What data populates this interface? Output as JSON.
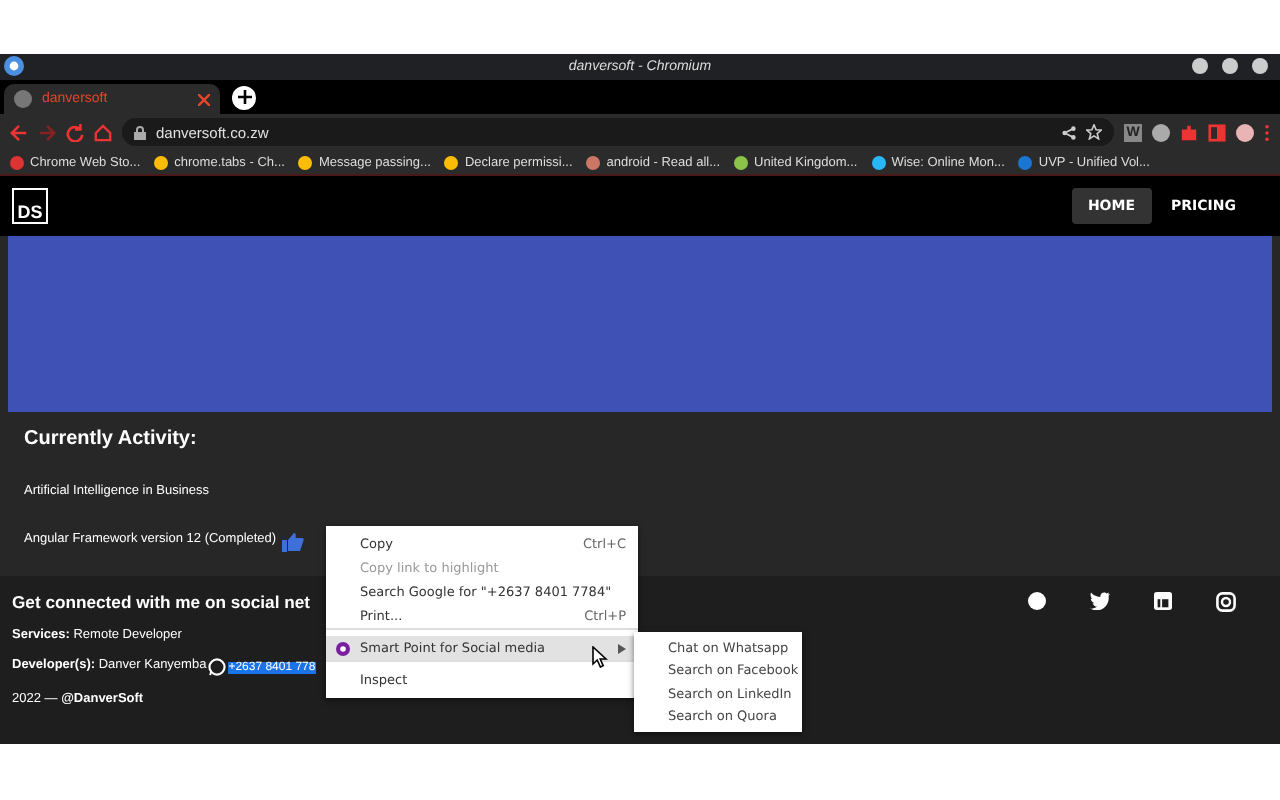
{
  "window": {
    "title": "danversoft - Chromium"
  },
  "tabs": [
    {
      "label": "danversoft",
      "selected": true
    }
  ],
  "address_bar": {
    "url": "danversoft.co.zw"
  },
  "extensions": [
    {
      "label": "W"
    }
  ],
  "bookmarks": [
    {
      "label": "Chrome Web Sto..."
    },
    {
      "label": "chrome.tabs - Ch..."
    },
    {
      "label": "Message passing..."
    },
    {
      "label": "Declare permissi..."
    },
    {
      "label": "android - Read all..."
    },
    {
      "label": "United Kingdom..."
    },
    {
      "label": "Wise: Online Mon..."
    },
    {
      "label": "UVP - Unified Vol..."
    }
  ],
  "site": {
    "logo": "DS",
    "nav": [
      {
        "label": "HOME",
        "selected": true
      },
      {
        "label": "PRICING",
        "selected": false
      }
    ],
    "activity_heading": "Currently Activity:",
    "activities": [
      {
        "text": "Artificial Intelligence in Business",
        "thumbs_up": false
      },
      {
        "text": "Angular Framework version 12 (Completed)",
        "thumbs_up": true
      }
    ],
    "footer_heading": "Get connected with me on social net",
    "services": {
      "label": "Services:",
      "value": "Remote Developer"
    },
    "developer": {
      "label": "Developer(s):",
      "name": "Danver Kanyemba",
      "phone": "+2637 8401 778",
      "phone_selected": true
    },
    "copyright": "2022 — ",
    "copyright_handle": "@DanverSoft"
  },
  "context_menu": {
    "items": [
      {
        "label": "Copy",
        "shortcut": "Ctrl+C",
        "disabled": false,
        "selected": false,
        "submenu": false,
        "separator_after": false
      },
      {
        "label": "Copy link to highlight",
        "disabled": true,
        "selected": false,
        "submenu": false,
        "separator_after": false
      },
      {
        "label": "Search Google for \"+2637 8401 7784\"",
        "disabled": false,
        "selected": false,
        "submenu": false,
        "separator_after": false
      },
      {
        "label": "Print...",
        "shortcut": "Ctrl+P",
        "disabled": false,
        "selected": false,
        "submenu": false,
        "separator_after": true
      },
      {
        "label": "Smart Point for Social media",
        "disabled": false,
        "selected": true,
        "submenu": true,
        "separator_after": true
      },
      {
        "label": "Inspect",
        "disabled": false,
        "selected": false,
        "submenu": false,
        "separator_after": false
      }
    ]
  },
  "submenu": {
    "items": [
      {
        "label": "Chat on Whatsapp"
      },
      {
        "label": "Search on Facebook"
      },
      {
        "label": "Search on LinkedIn"
      },
      {
        "label": "Search on Quora"
      }
    ]
  }
}
